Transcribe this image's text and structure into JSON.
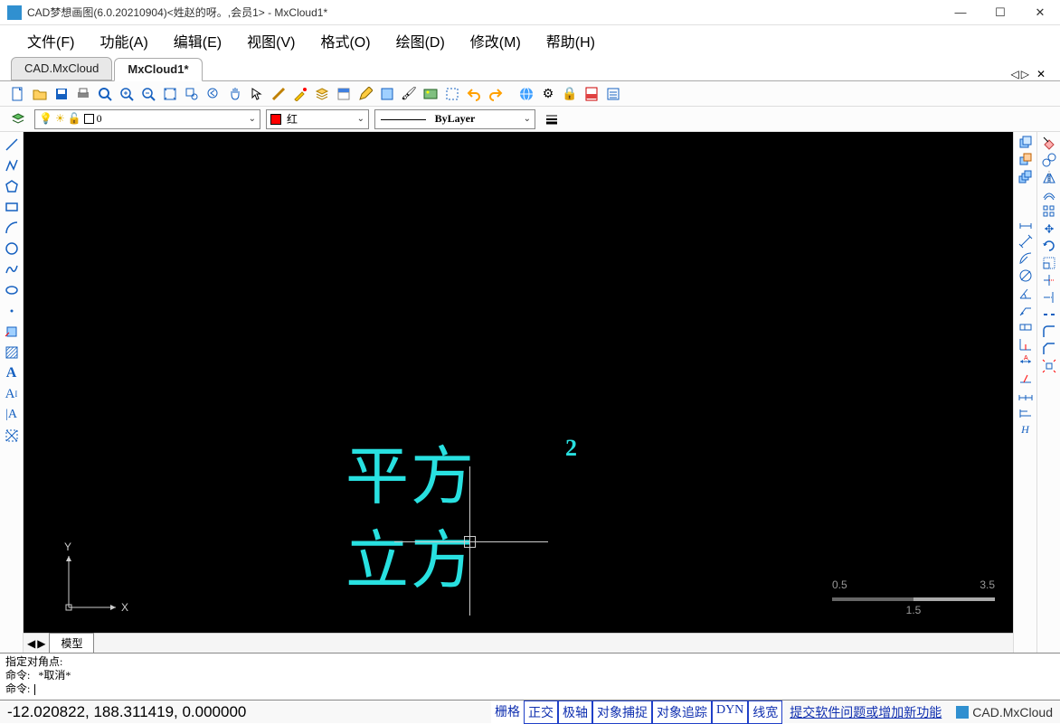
{
  "title": "CAD梦想画图(6.0.20210904)<姓赵的呀。,会员1> - MxCloud1*",
  "menu": {
    "file": "文件(F)",
    "func": "功能(A)",
    "edit": "编辑(E)",
    "view": "视图(V)",
    "format": "格式(O)",
    "draw": "绘图(D)",
    "modify": "修改(M)",
    "help": "帮助(H)"
  },
  "tabs": {
    "t1": "CAD.MxCloud",
    "t2": "MxCloud1*"
  },
  "layer": {
    "name": "0"
  },
  "color": {
    "name": "红",
    "swatch": "#ff0000"
  },
  "linetype": {
    "name": "ByLayer"
  },
  "canvas_text": {
    "line1": "平方",
    "line2": "立方",
    "sup": "2"
  },
  "scale": {
    "left": "0.5",
    "right": "3.5",
    "mid": "1.5"
  },
  "ucs": {
    "x": "X",
    "y": "Y"
  },
  "model_tab": "模型",
  "cmd": {
    "l1": "指定对角点:",
    "l2": "命令:   *取消*",
    "l3": "命令:"
  },
  "status": {
    "coord": "-12.020822,  188.311419,  0.000000",
    "grid": "栅格",
    "ortho": "正交",
    "polar": "极轴",
    "osnap": "对象捕捉",
    "otrack": "对象追踪",
    "dyn": "DYN",
    "lwt": "线宽",
    "feedback": "提交软件问题或增加新功能",
    "brand": "CAD.MxCloud"
  }
}
